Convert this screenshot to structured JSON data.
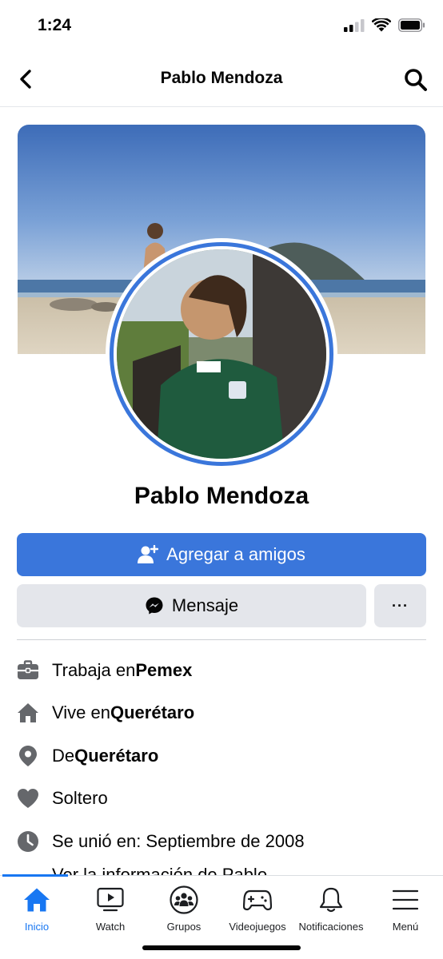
{
  "status_bar": {
    "time": "1:24"
  },
  "nav": {
    "title": "Pablo Mendoza"
  },
  "profile": {
    "name": "Pablo Mendoza"
  },
  "actions": {
    "add_friend_label": "Agregar a amigos",
    "message_label": "Mensaje",
    "more_label": "···"
  },
  "info": {
    "work": {
      "prefix": "Trabaja en ",
      "value": "Pemex"
    },
    "lives": {
      "prefix": "Vive en ",
      "value": "Querétaro"
    },
    "from": {
      "prefix": "De ",
      "value": "Querétaro"
    },
    "relationship": {
      "text": "Soltero"
    },
    "joined": {
      "text": "Se unió en: Septiembre de 2008"
    },
    "see_more": "Ver la información de Pablo"
  },
  "tabs": [
    {
      "label": "Inicio",
      "icon": "home-icon",
      "active": true
    },
    {
      "label": "Watch",
      "icon": "watch-icon"
    },
    {
      "label": "Grupos",
      "icon": "groups-icon"
    },
    {
      "label": "Videojuegos",
      "icon": "gaming-icon"
    },
    {
      "label": "Notificaciones",
      "icon": "bell-icon"
    },
    {
      "label": "Menú",
      "icon": "menu-icon"
    }
  ],
  "colors": {
    "accent": "#3a76db",
    "tab_active": "#1877f2",
    "button_gray": "#e4e6eb",
    "icon_gray": "#65676b"
  }
}
